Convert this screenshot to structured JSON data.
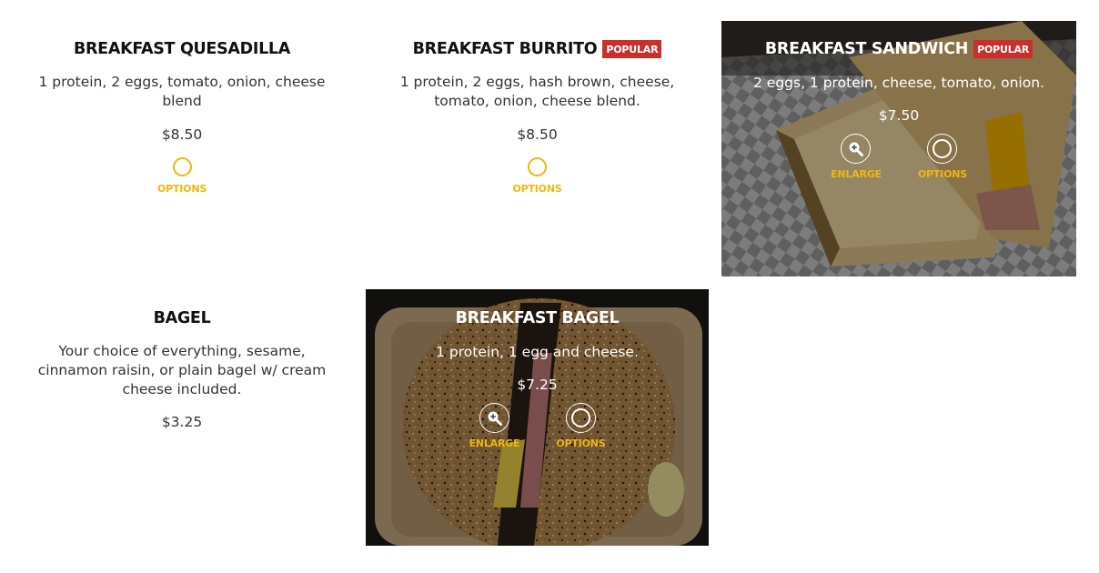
{
  "colors": {
    "accent": "#f0b70f",
    "badge": "#c9302c",
    "text": "#222222"
  },
  "icons": {
    "enlarge": "zoom-in-icon",
    "options": "options-circle-icon"
  },
  "items": [
    {
      "title": "BREAKFAST QUESADILLA",
      "description": "1 protein, 2 eggs, tomato, onion, cheese blend",
      "price": "$8.50",
      "options_label": "OPTIONS"
    },
    {
      "title": "BREAKFAST BURRITO",
      "badge": "POPULAR",
      "description": "1 protein, 2 eggs, hash brown, cheese, tomato, onion, cheese blend.",
      "price": "$8.50",
      "options_label": "OPTIONS"
    },
    {
      "title": "BREAKFAST SANDWICH",
      "badge": "POPULAR",
      "description": "2 eggs, 1 protein, cheese, tomato, onion.",
      "price": "$7.50",
      "enlarge_label": "ENLARGE",
      "options_label": "OPTIONS"
    },
    {
      "title": "BAGEL",
      "description": "Your choice of everything, sesame, cinnamon raisin, or plain bagel w/ cream cheese included.",
      "price": "$3.25"
    },
    {
      "title": "BREAKFAST BAGEL",
      "description": "1 protein, 1 egg and cheese.",
      "price": "$7.25",
      "enlarge_label": "ENLARGE",
      "options_label": "OPTIONS"
    }
  ]
}
